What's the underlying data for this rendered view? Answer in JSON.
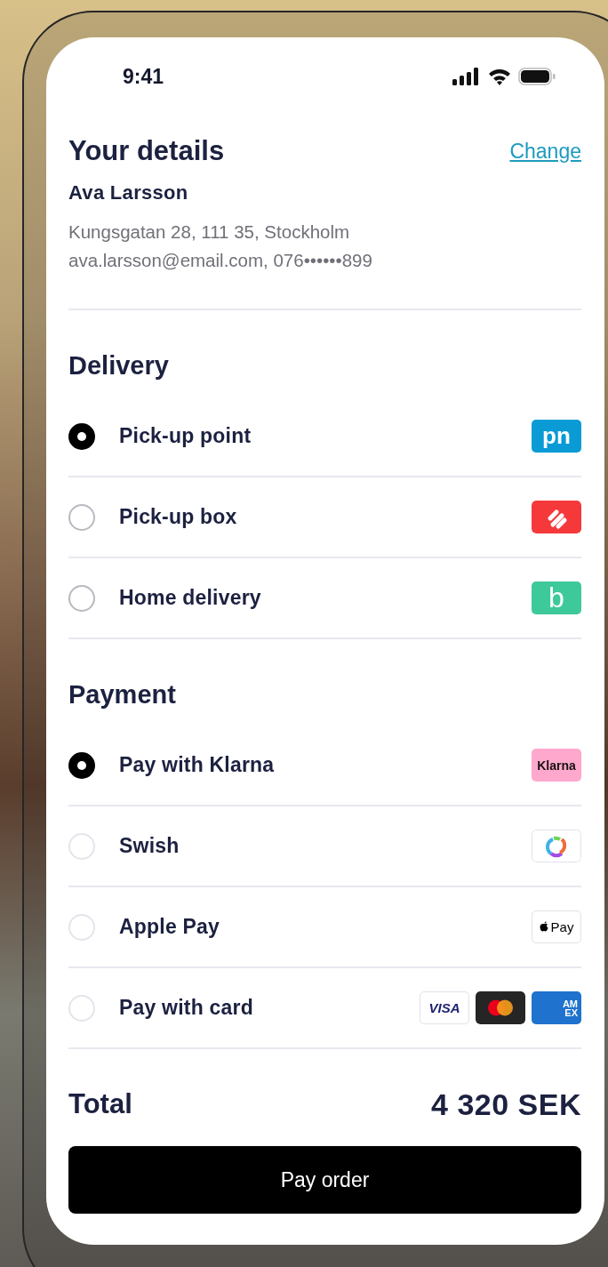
{
  "status_bar": {
    "time": "9:41"
  },
  "details": {
    "title": "Your details",
    "action": "Change",
    "name": "Ava Larsson",
    "address": "Kungsgatan 28, 111 35, Stockholm",
    "contact": "ava.larsson@email.com, 076••••••899"
  },
  "delivery": {
    "title": "Delivery",
    "options": [
      {
        "label": "Pick-up point",
        "selected": true,
        "logos": [
          {
            "kind": "pn",
            "text": "pn"
          }
        ]
      },
      {
        "label": "Pick-up box",
        "selected": false,
        "logos": [
          {
            "kind": "stripes"
          }
        ]
      },
      {
        "label": "Home delivery",
        "selected": false,
        "logos": [
          {
            "kind": "b",
            "text": "b"
          }
        ]
      }
    ]
  },
  "payment": {
    "title": "Payment",
    "options": [
      {
        "label": "Pay with Klarna",
        "selected": true,
        "logos": [
          {
            "kind": "klarna",
            "text": "Klarna"
          }
        ]
      },
      {
        "label": "Swish",
        "selected": false,
        "logos": [
          {
            "kind": "ring"
          }
        ]
      },
      {
        "label": "Apple Pay",
        "selected": false,
        "logos": [
          {
            "kind": "applepay",
            "text": "Pay"
          }
        ]
      },
      {
        "label": "Pay with card",
        "selected": false,
        "logos": [
          {
            "kind": "visa",
            "text": "VISA"
          },
          {
            "kind": "circles"
          },
          {
            "kind": "amex",
            "lines": [
              "AM",
              "EX"
            ]
          }
        ]
      }
    ]
  },
  "total": {
    "label": "Total",
    "amount": "4 320 SEK"
  },
  "button": "Pay order"
}
